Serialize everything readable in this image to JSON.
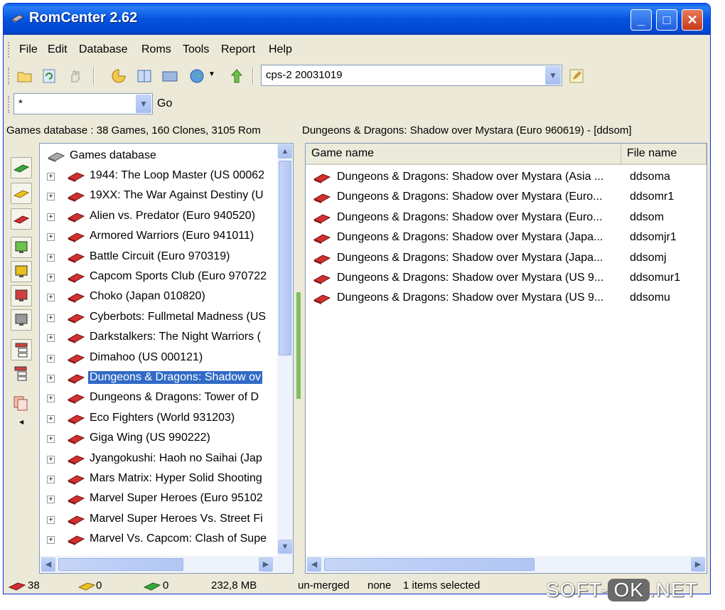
{
  "window": {
    "title": "RomCenter 2.62",
    "minimize_label": "_",
    "maximize_label": "□",
    "close_label": "✕"
  },
  "menu": {
    "items": [
      "File",
      "Edit",
      "Database",
      "Roms",
      "Tools",
      "Report",
      "Help"
    ]
  },
  "toolbar": {
    "database_combo_value": "cps-2 20031019"
  },
  "filter": {
    "value": "*",
    "go_label": "Go"
  },
  "panels": {
    "left_status": "Games database : 38 Games, 160 Clones, 3105 Rom",
    "right_status": "Dungeons & Dragons: Shadow over Mystara (Euro 960619) - [ddsom]"
  },
  "tree": {
    "root_label": "Games database",
    "items": [
      "1944: The Loop Master (US 00062",
      "19XX: The War Against Destiny (U",
      "Alien vs. Predator (Euro 940520)",
      "Armored Warriors (Euro 941011)",
      "Battle Circuit (Euro 970319)",
      "Capcom Sports Club (Euro 970722",
      "Choko (Japan 010820)",
      "Cyberbots: Fullmetal Madness (US",
      "Darkstalkers: The Night Warriors (",
      "Dimahoo (US 000121)",
      "Dungeons & Dragons: Shadow ov",
      "Dungeons & Dragons: Tower of D",
      "Eco Fighters (World 931203)",
      "Giga Wing (US 990222)",
      "Jyangokushi: Haoh no Saihai (Jap",
      "Mars Matrix: Hyper Solid Shooting",
      "Marvel Super Heroes (Euro 95102",
      "Marvel Super Heroes Vs. Street Fi",
      "Marvel Vs. Capcom: Clash of Supe"
    ],
    "selected_index": 10
  },
  "list": {
    "columns": [
      "Game name",
      "File name"
    ],
    "rows": [
      {
        "name": "Dungeons & Dragons: Shadow over Mystara (Asia ...",
        "file": "ddsoma"
      },
      {
        "name": "Dungeons & Dragons: Shadow over Mystara (Euro...",
        "file": "ddsomr1"
      },
      {
        "name": "Dungeons & Dragons: Shadow over Mystara (Euro...",
        "file": "ddsom"
      },
      {
        "name": "Dungeons & Dragons: Shadow over Mystara (Japa...",
        "file": "ddsomjr1"
      },
      {
        "name": "Dungeons & Dragons: Shadow over Mystara (Japa...",
        "file": "ddsomj"
      },
      {
        "name": "Dungeons & Dragons: Shadow over Mystara (US 9...",
        "file": "ddsomur1"
      },
      {
        "name": "Dungeons & Dragons: Shadow over Mystara (US 9...",
        "file": "ddsomu"
      }
    ]
  },
  "statusbar": {
    "red_count": "38",
    "yellow_count": "0",
    "green_count": "0",
    "size": "232,8 MB",
    "mode": "un-merged",
    "filter": "none",
    "selection": "1 items selected"
  },
  "watermark": {
    "left": "SOFT-",
    "ok": "OK",
    "right": ".NET"
  },
  "colors": {
    "title_blue": "#0453e0",
    "selection_blue": "#316ac5",
    "rom_red": "#d03030",
    "rom_yellow": "#e8c020",
    "rom_green": "#38a838"
  },
  "icons": [
    "window-icon",
    "open-icon",
    "refresh-icon",
    "hand-icon",
    "scan-icon",
    "book-icon",
    "card-icon",
    "globe-icon",
    "arrow-up-icon",
    "edit-icon",
    "rom-icon"
  ]
}
